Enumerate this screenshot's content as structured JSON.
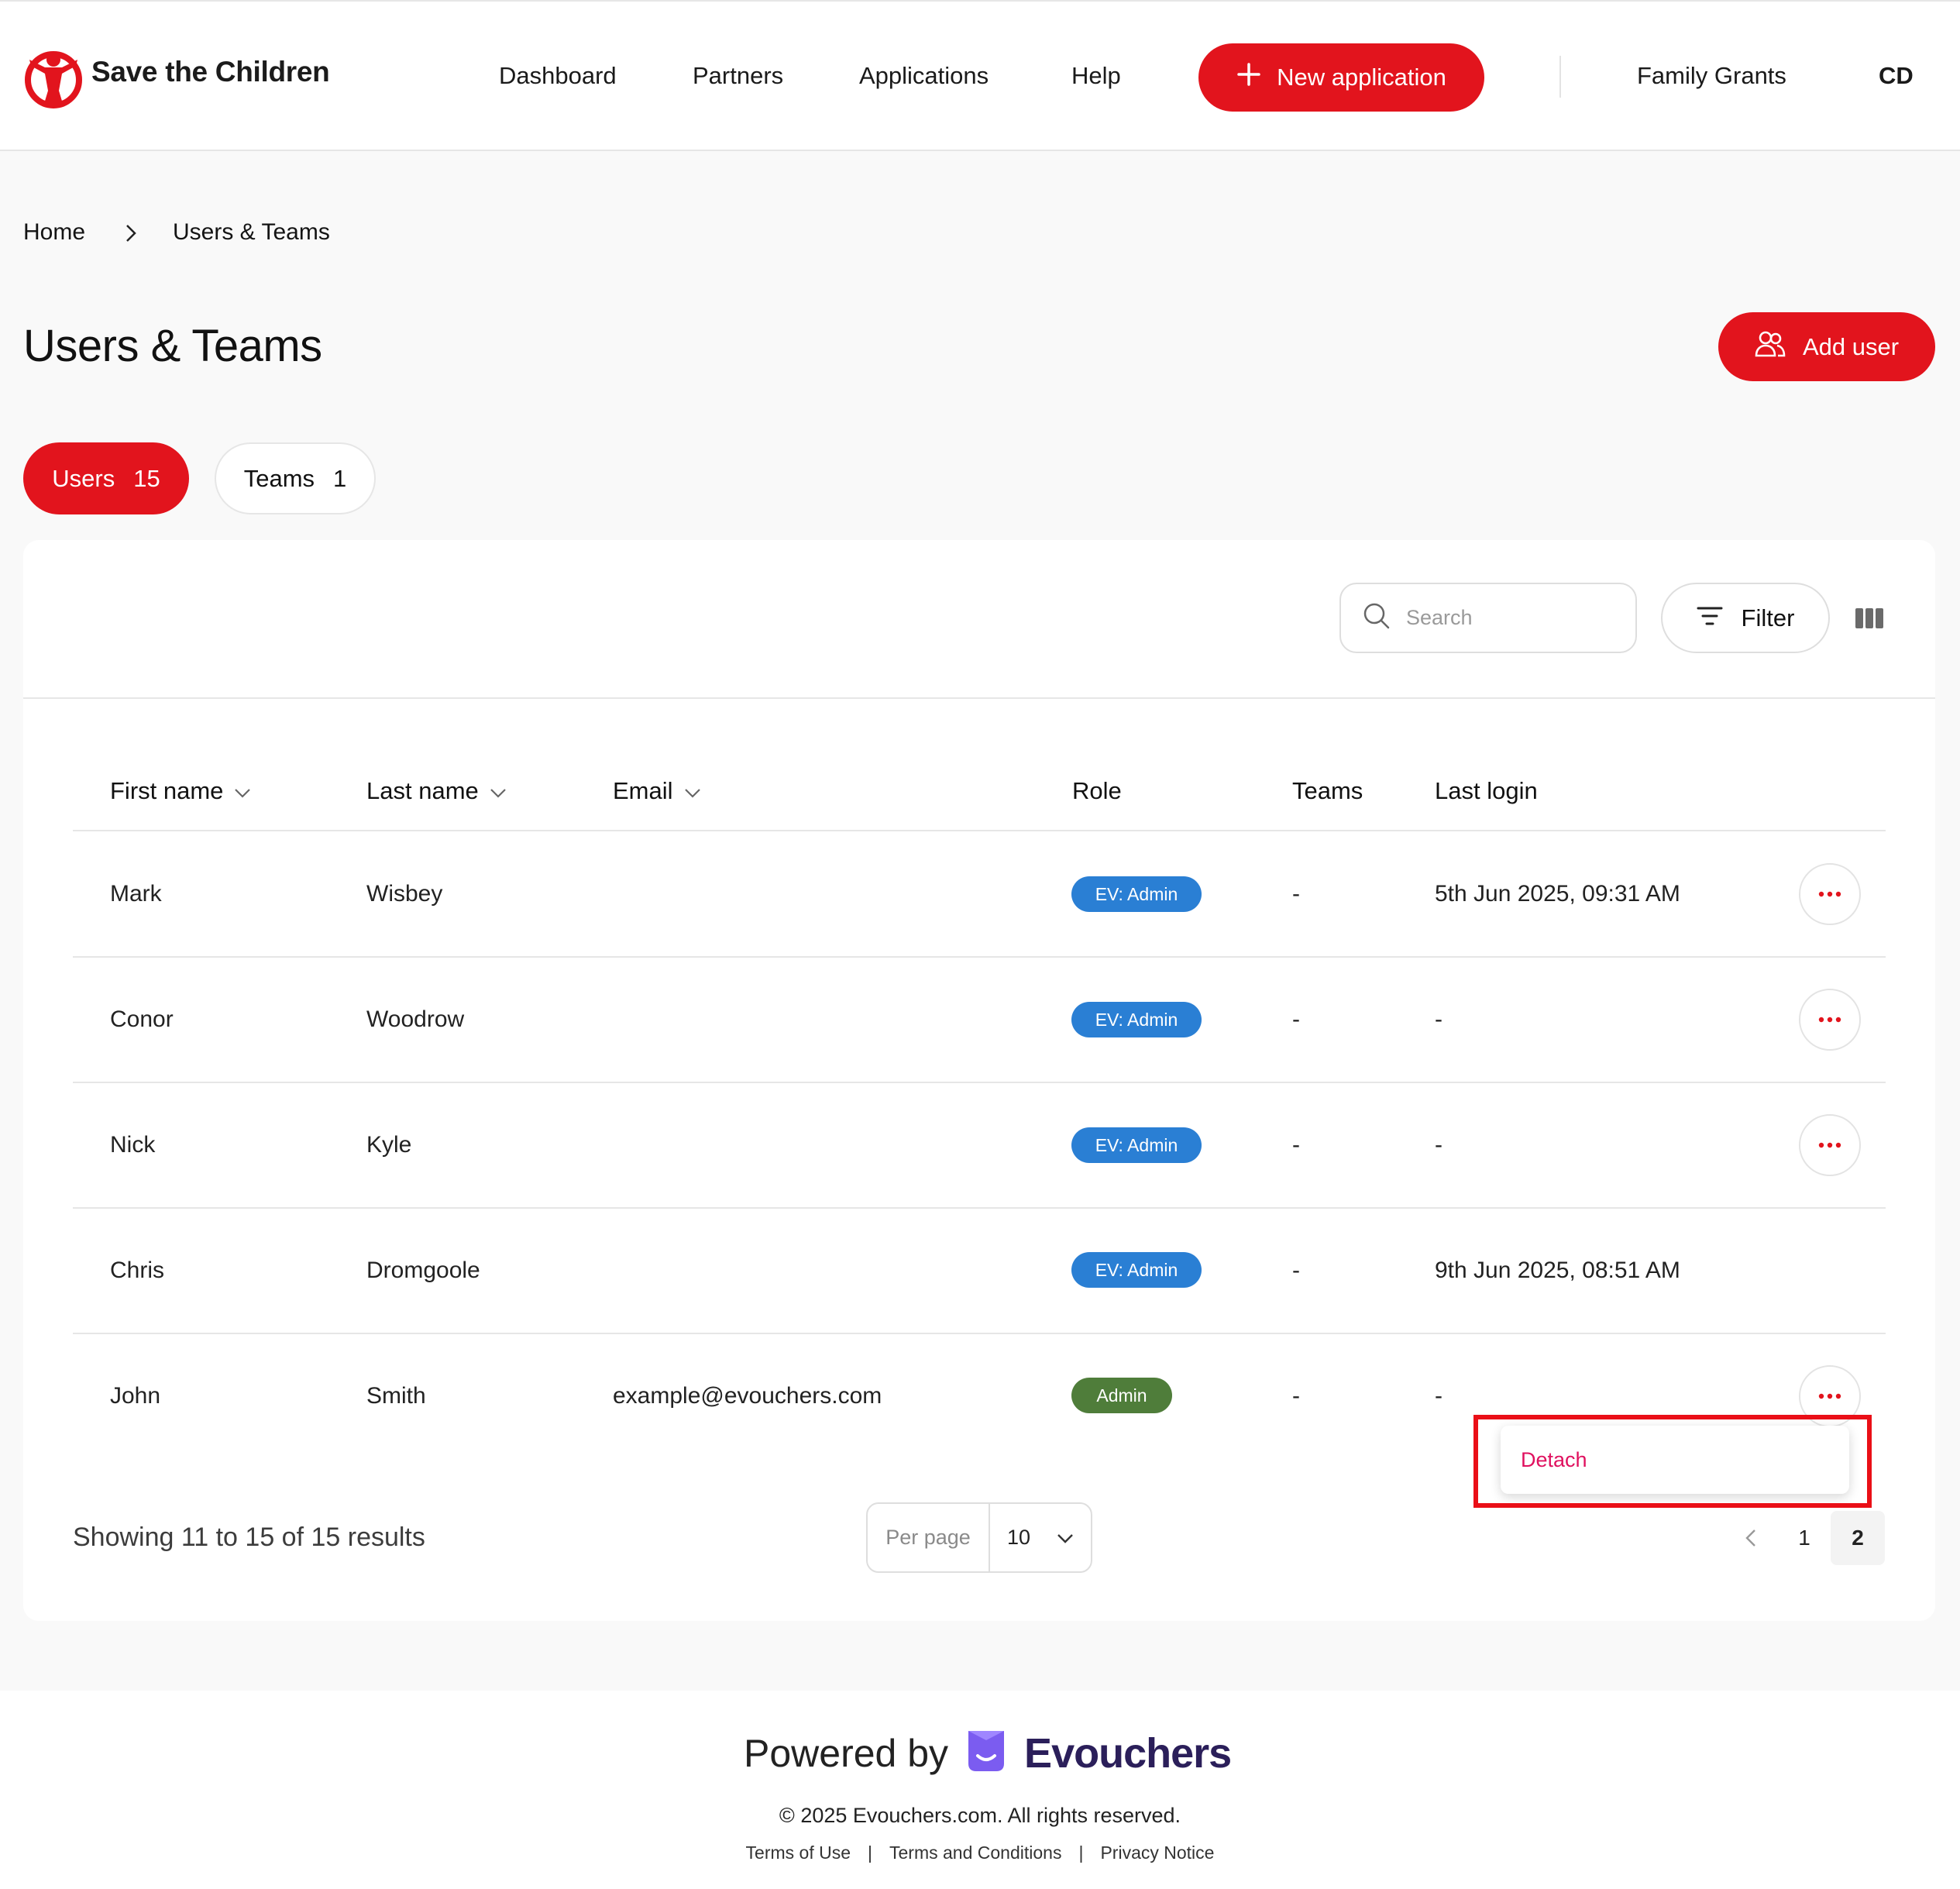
{
  "header": {
    "brand": "Save the Children",
    "nav": [
      "Dashboard",
      "Partners",
      "Applications",
      "Help"
    ],
    "new_application": "New application",
    "org": "Family Grants",
    "user_initials": "CD"
  },
  "breadcrumb": {
    "home": "Home",
    "current": "Users & Teams"
  },
  "page": {
    "title": "Users & Teams",
    "add_user": "Add user"
  },
  "tabs": [
    {
      "label": "Users",
      "count": "15",
      "active": true
    },
    {
      "label": "Teams",
      "count": "1",
      "active": false
    }
  ],
  "toolbar": {
    "search_placeholder": "Search",
    "filter_label": "Filter"
  },
  "table": {
    "columns": [
      "First name",
      "Last name",
      "Email",
      "Role",
      "Teams",
      "Last login"
    ],
    "rows": [
      {
        "first": "Mark",
        "last": "Wisbey",
        "email": "",
        "role": "EV: Admin",
        "teams": "-",
        "last_login": "5th Jun 2025, 09:31 AM"
      },
      {
        "first": "Conor",
        "last": "Woodrow",
        "email": "",
        "role": "EV: Admin",
        "teams": "-",
        "last_login": "-"
      },
      {
        "first": "Nick",
        "last": "Kyle",
        "email": "",
        "role": "EV: Admin",
        "teams": "-",
        "last_login": "-"
      },
      {
        "first": "Chris",
        "last": "Dromgoole",
        "email": "",
        "role": "EV: Admin",
        "teams": "-",
        "last_login": "9th Jun 2025, 08:51 AM"
      },
      {
        "first": "John",
        "last": "Smith",
        "email": "example@evouchers.com",
        "role": "Admin",
        "teams": "-",
        "last_login": "-"
      }
    ]
  },
  "row_menu": {
    "detach": "Detach"
  },
  "pagination": {
    "showing": "Showing 11 to 15 of 15 results",
    "per_page_label": "Per page",
    "per_page_value": "10",
    "pages": [
      "1",
      "2"
    ],
    "current_page": "2"
  },
  "footer": {
    "powered_by": "Powered by",
    "brand": "Evouchers",
    "copyright": "© 2025 Evouchers.com. All rights reserved.",
    "links": [
      "Terms of Use",
      "Terms and Conditions",
      "Privacy Notice"
    ]
  },
  "colors": {
    "primary": "#e2141d",
    "badge_ev_admin": "#2a7fd4",
    "badge_admin": "#4f7d3a",
    "menu_text": "#e0115f",
    "evouchers_purple": "#7b5cf0"
  }
}
